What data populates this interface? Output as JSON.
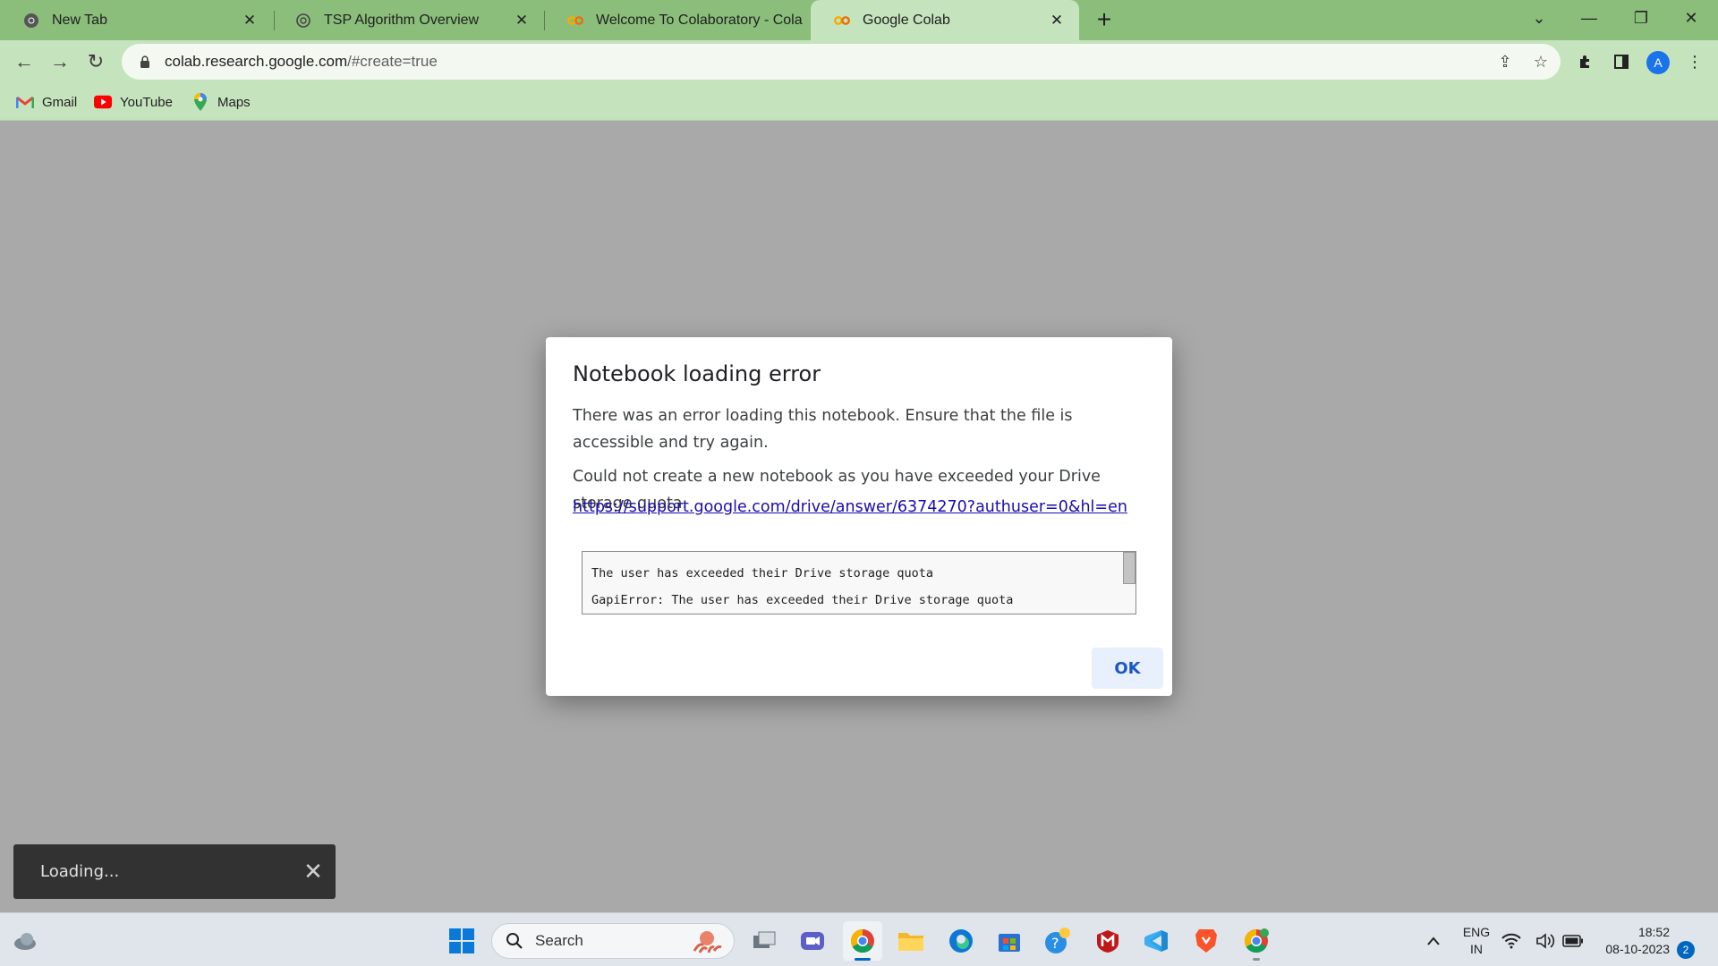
{
  "browser": {
    "tabs": [
      {
        "title": "New Tab",
        "icon": "chrome-icon",
        "active": false
      },
      {
        "title": "TSP Algorithm Overview",
        "icon": "chatgpt-icon",
        "active": false
      },
      {
        "title": "Welcome To Colaboratory - Cola",
        "icon": "colab-icon",
        "active": false
      },
      {
        "title": "Google Colab",
        "icon": "colab-icon",
        "active": true
      }
    ],
    "address_bar": {
      "host": "colab.research.google.com",
      "path": "/#create=true"
    },
    "profile_initial": "A",
    "bookmarks": [
      {
        "label": "Gmail",
        "icon": "gmail-icon"
      },
      {
        "label": "YouTube",
        "icon": "youtube-icon"
      },
      {
        "label": "Maps",
        "icon": "maps-icon"
      }
    ]
  },
  "dialog": {
    "title": "Notebook loading error",
    "message_1": "There was an error loading this notebook. Ensure that the file is accessible and try again.",
    "message_2": "Could not create a new notebook as you have exceeded your Drive storage quota.",
    "link": "https://support.google.com/drive/answer/6374270?authuser=0&hl=en",
    "error_lines": [
      "The user has exceeded their Drive storage quota",
      "GapiError: The user has exceeded their Drive storage quota"
    ],
    "ok_label": "OK"
  },
  "snackbar": {
    "text": "Loading..."
  },
  "taskbar": {
    "search_placeholder": "Search",
    "language": "ENG",
    "region": "IN",
    "time": "18:52",
    "date": "08-10-2023",
    "notification_count": "2"
  },
  "colors": {
    "tab_strip": "#8bbe7b",
    "toolbar": "#c5e3bd",
    "page_overlay": "#a9a9a9",
    "link": "#1a0dab",
    "ok_button_bg": "#e8f0fe"
  }
}
